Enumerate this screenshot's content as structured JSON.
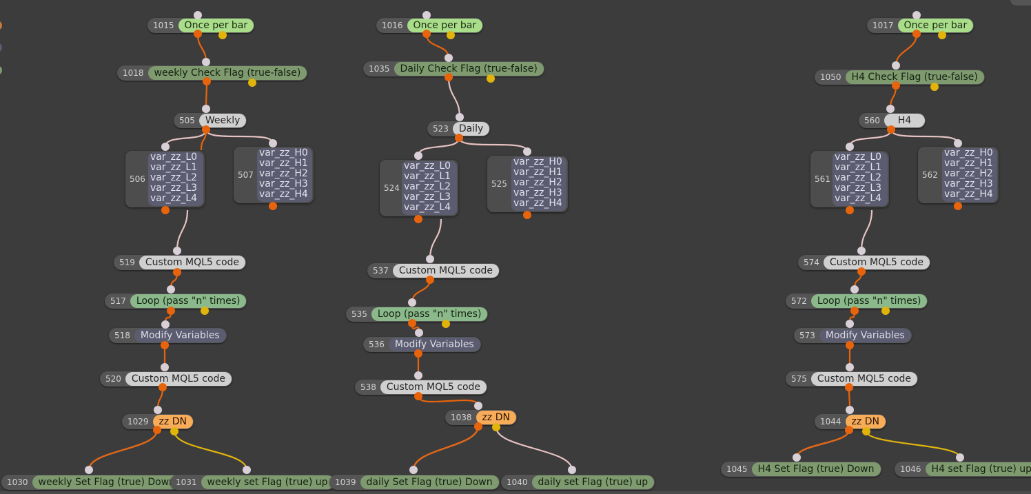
{
  "colors": {
    "wire_orange": "#e8640c",
    "wire_pink": "#e6c2c2",
    "wire_yellow": "#e1b40c",
    "canvas_bg": "#3c3c3c"
  },
  "nodes": {
    "n1015": {
      "id": "1015",
      "label": "Once per bar"
    },
    "n1018": {
      "id": "1018",
      "label": "weekly Check Flag (true-false)"
    },
    "n505": {
      "id": "505",
      "label": "Weekly"
    },
    "n506": {
      "id": "506",
      "vars": [
        "var_zz_L0",
        "var_zz_L1",
        "var_zz_L2",
        "var_zz_L3",
        "var_zz_L4"
      ]
    },
    "n507": {
      "id": "507",
      "vars": [
        "var_zz_H0",
        "var_zz_H1",
        "var_zz_H2",
        "var_zz_H3",
        "var_zz_H4"
      ]
    },
    "n519": {
      "id": "519",
      "label": "Custom MQL5 code"
    },
    "n517": {
      "id": "517",
      "label": "Loop (pass \"n\" times)"
    },
    "n518": {
      "id": "518",
      "label": "Modify Variables"
    },
    "n520": {
      "id": "520",
      "label": "Custom MQL5 code"
    },
    "n1029": {
      "id": "1029",
      "label": "zz DN"
    },
    "n1030": {
      "id": "1030",
      "label": "weekly Set Flag (true) Down"
    },
    "n1031": {
      "id": "1031",
      "label": "weekly set Flag (true) up"
    },
    "n1016": {
      "id": "1016",
      "label": "Once per bar"
    },
    "n1035": {
      "id": "1035",
      "label": "Daily Check Flag (true-false)"
    },
    "n523": {
      "id": "523",
      "label": "Daily"
    },
    "n524": {
      "id": "524",
      "vars": [
        "var_zz_L0",
        "var_zz_L1",
        "var_zz_L2",
        "var_zz_L3",
        "var_zz_L4"
      ]
    },
    "n525": {
      "id": "525",
      "vars": [
        "var_zz_H0",
        "var_zz_H1",
        "var_zz_H2",
        "var_zz_H3",
        "var_zz_H4"
      ]
    },
    "n537": {
      "id": "537",
      "label": "Custom MQL5 code"
    },
    "n535": {
      "id": "535",
      "label": "Loop (pass \"n\" times)"
    },
    "n536": {
      "id": "536",
      "label": "Modify Variables"
    },
    "n538": {
      "id": "538",
      "label": "Custom MQL5 code"
    },
    "n1038": {
      "id": "1038",
      "label": "zz DN"
    },
    "n1039": {
      "id": "1039",
      "label": "daily Set Flag (true) Down"
    },
    "n1040": {
      "id": "1040",
      "label": "daily set Flag (true) up"
    },
    "n1017": {
      "id": "1017",
      "label": "Once per bar"
    },
    "n1050": {
      "id": "1050",
      "label": "H4 Check Flag (true-false)"
    },
    "n560": {
      "id": "560",
      "label": "H4"
    },
    "n561": {
      "id": "561",
      "vars": [
        "var_zz_L0",
        "var_zz_L1",
        "var_zz_L2",
        "var_zz_L3",
        "var_zz_L4"
      ]
    },
    "n562": {
      "id": "562",
      "vars": [
        "var_zz_H0",
        "var_zz_H1",
        "var_zz_H2",
        "var_zz_H3",
        "var_zz_H4"
      ]
    },
    "n574": {
      "id": "574",
      "label": "Custom MQL5 code"
    },
    "n572": {
      "id": "572",
      "label": "Loop (pass \"n\" times)"
    },
    "n573": {
      "id": "573",
      "label": "Modify Variables"
    },
    "n575": {
      "id": "575",
      "label": "Custom MQL5 code"
    },
    "n1044": {
      "id": "1044",
      "label": "zz DN"
    },
    "n1045": {
      "id": "1045",
      "label": "H4 Set Flag (true) Down"
    },
    "n1046": {
      "id": "1046",
      "label": "H4 set Flag (true) up"
    }
  }
}
